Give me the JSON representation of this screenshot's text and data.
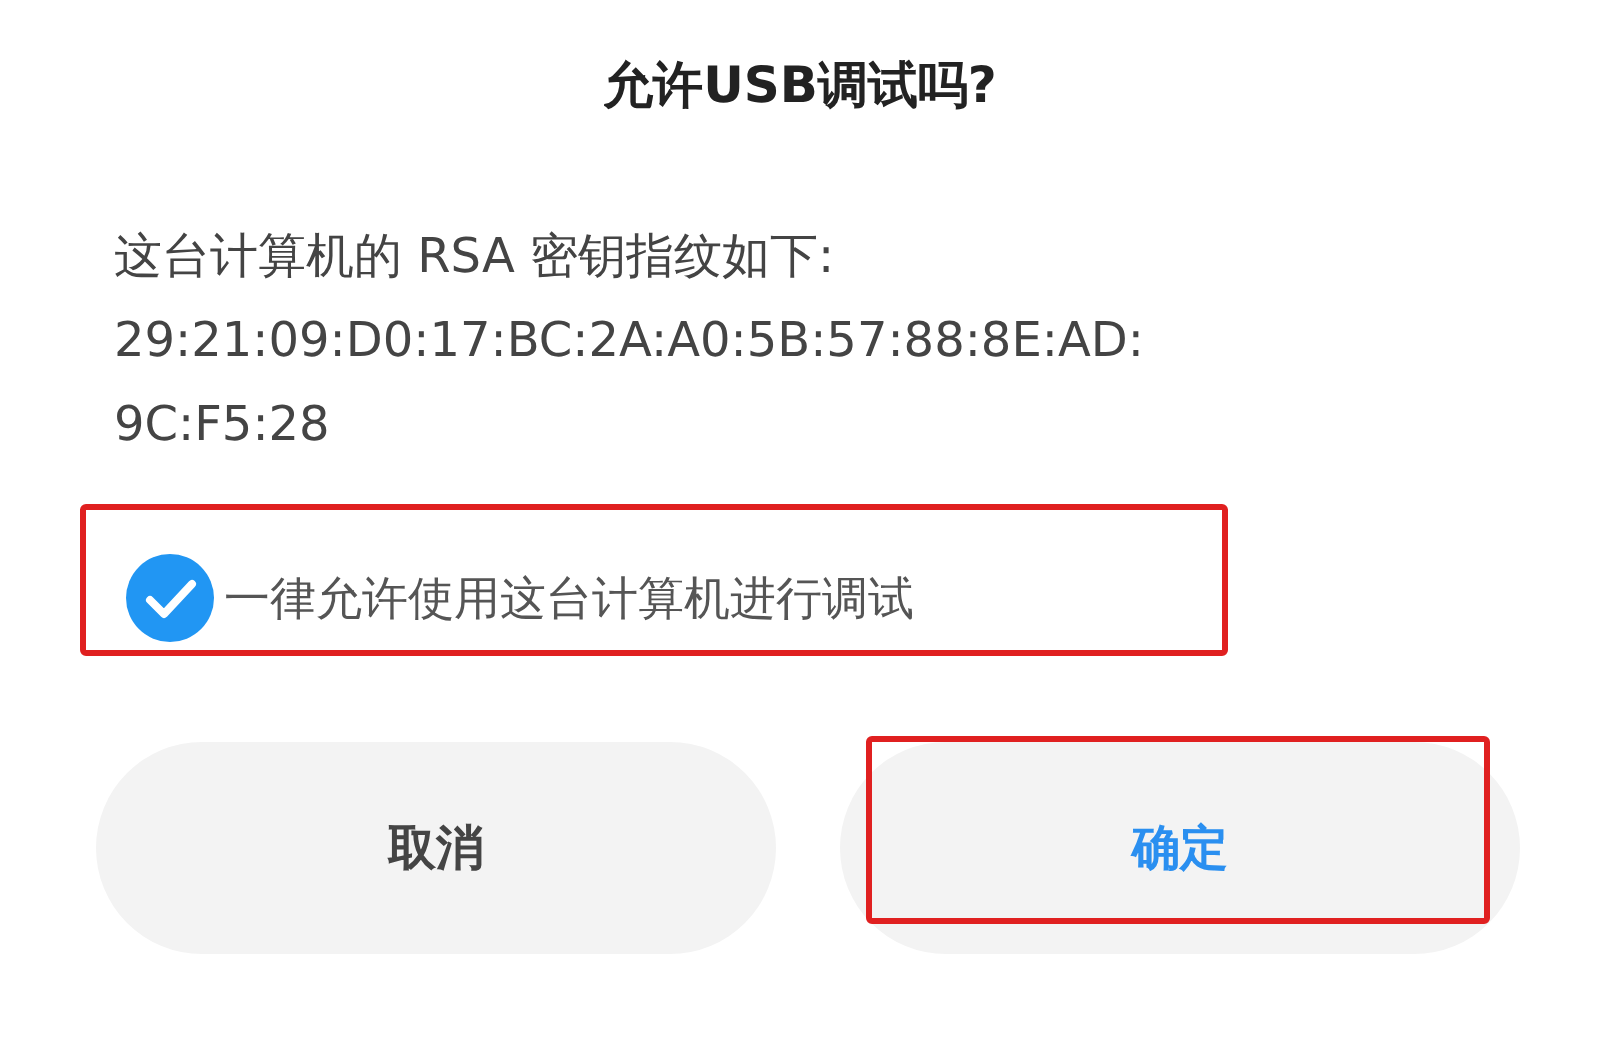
{
  "dialog": {
    "title": "允许USB调试吗?",
    "message_lines": [
      "这台计算机的 RSA 密钥指纹如下:",
      "29:21:09:D0:17:BC:2A:A0:5B:57:88:8E:AD:",
      "9C:F5:28"
    ],
    "checkbox": {
      "label": "一律允许使用这台计算机进行调试",
      "checked": true,
      "highlighted": true
    },
    "buttons": [
      {
        "label": "取消",
        "kind": "cancel",
        "highlighted": false
      },
      {
        "label": "确定",
        "kind": "confirm",
        "highlighted": true
      }
    ]
  }
}
